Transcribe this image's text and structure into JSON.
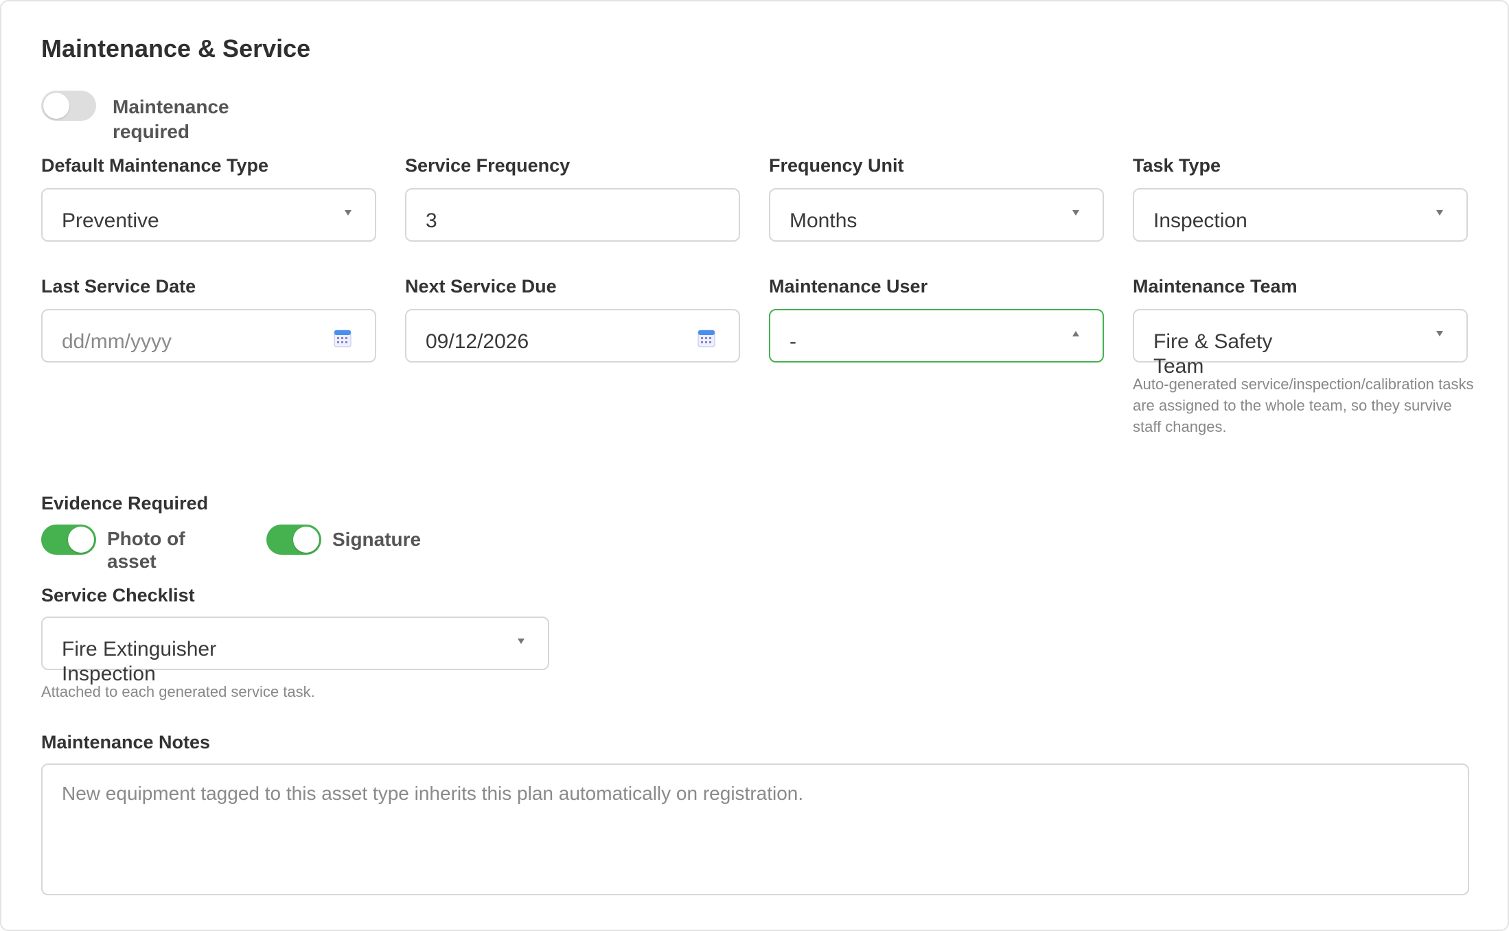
{
  "section": {
    "title": "Maintenance & Service"
  },
  "maintenance_required": {
    "label": "Maintenance required",
    "on": false
  },
  "fields": {
    "default_maintenance_type": {
      "label": "Default Maintenance Type",
      "value": "Preventive"
    },
    "service_frequency": {
      "label": "Service Frequency",
      "value": "3"
    },
    "frequency_unit": {
      "label": "Frequency Unit",
      "value": "Months"
    },
    "task_type": {
      "label": "Task Type",
      "value": "Inspection"
    },
    "last_service_date": {
      "label": "Last Service Date",
      "placeholder": "dd/mm/yyyy"
    },
    "next_service_due": {
      "label": "Next Service Due",
      "value": "09/12/2026"
    },
    "maintenance_user": {
      "label": "Maintenance User",
      "value": "-"
    },
    "maintenance_team": {
      "label": "Maintenance Team",
      "value": "Fire & Safety Team",
      "help": "Auto-generated service/inspection/calibration tasks are assigned to the whole team, so they survive staff changes."
    }
  },
  "evidence": {
    "label": "Evidence Required",
    "photo": {
      "label": "Photo of asset",
      "on": true
    },
    "signature": {
      "label": "Signature",
      "on": true
    }
  },
  "checklist": {
    "label": "Service Checklist",
    "value": "Fire Extinguisher Inspection",
    "help": "Attached to each generated service task."
  },
  "notes": {
    "label": "Maintenance Notes",
    "placeholder": "New equipment tagged to this asset type inherits this plan automatically on registration."
  },
  "colors": {
    "accent_green": "#45b14f",
    "border": "#d7d7d7",
    "toggle_off": "#dedede"
  },
  "icons": {
    "calendar": "calendar-icon",
    "dropdown": "chevron-down-icon",
    "dropdown_open": "chevron-up-icon"
  }
}
